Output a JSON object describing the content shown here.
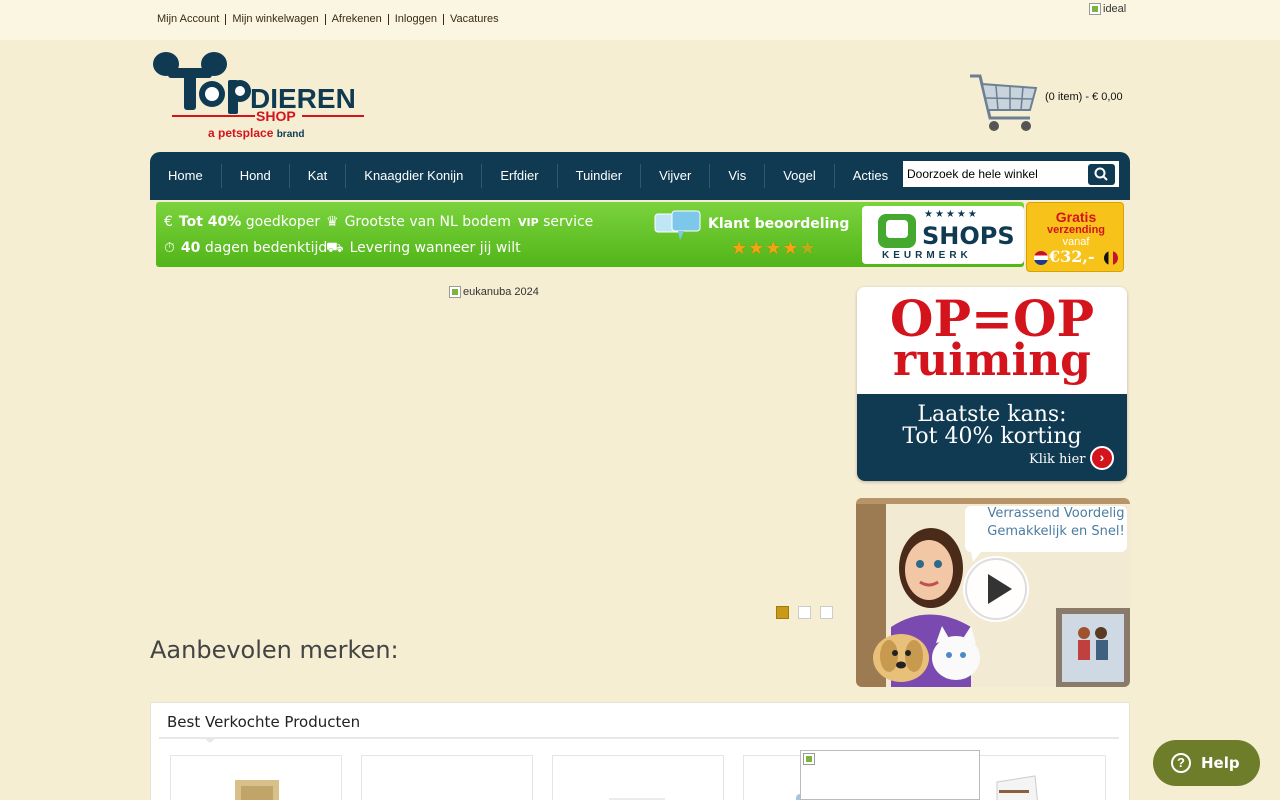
{
  "top_links": [
    "Mijn Account",
    "Mijn winkelwagen",
    "Afrekenen",
    "Inloggen",
    "Vacatures"
  ],
  "ideal_alt": "ideal",
  "logo": {
    "top": "TOP",
    "dieren": "DIEREN",
    "shop": "SHOP",
    "tagline": "a petsplace brand"
  },
  "cart": {
    "text": "(0 item) - € 0,00"
  },
  "nav": {
    "items": [
      "Home",
      "Hond",
      "Kat",
      "Knaagdier Konijn",
      "Erfdier",
      "Tuindier",
      "Vijver",
      "Vis",
      "Vogel",
      "Acties"
    ],
    "search_placeholder": "Doorzoek de hele winkel"
  },
  "usp": {
    "line1_bold": "Tot 40%",
    "line1_rest": "goedkoper",
    "line1b": "Grootste van NL bodem",
    "line1c_vip": "VIP",
    "line1c": "service",
    "line2_bold": "40",
    "line2_rest": "dagen bedenktijd",
    "line2b": "Levering wanneer jij wilt",
    "klant": "Klant beoordeling",
    "rating_stars": 4.5,
    "qshops_name": "SHOPS",
    "qshops_sub": "KEURMERK",
    "gratis": "Gratis",
    "verzending": "verzending",
    "vanaf": "vanaf",
    "amount": "€32,-"
  },
  "hero": {
    "alt": "eukanuba 2024",
    "slides": 3,
    "active_slide": 1
  },
  "promo_op": {
    "line1": "OP=OP",
    "line2": "ruiming",
    "b1": "Laatste kans:",
    "b2": "Tot 40% korting",
    "cta": "Klik hier"
  },
  "promo_video": {
    "line1": "Verrassend Voordelig",
    "line2": "Gemakkelijk en Snel!"
  },
  "merken_title": "Aanbevolen merken:",
  "best": {
    "title": "Best Verkochte Producten"
  },
  "help_label": "Help"
}
